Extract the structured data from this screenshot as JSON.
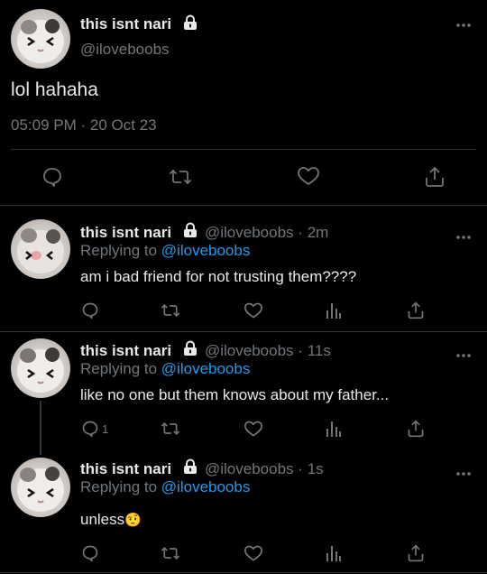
{
  "main_tweet": {
    "display_name": "this isnt nari",
    "handle": "@iloveboobs",
    "text": "lol hahaha",
    "time": "05:09 PM",
    "date": "20 Oct 23",
    "separator": "·"
  },
  "replies": [
    {
      "display_name": "this isnt nari",
      "handle": "@iloveboobs",
      "age": "2m",
      "replying_prefix": "Replying to",
      "replying_to": "@iloveboobs",
      "text": "am i bad friend for not trusting them????",
      "reply_count": ""
    },
    {
      "display_name": "this isnt nari",
      "handle": "@iloveboobs",
      "age": "11s",
      "replying_prefix": "Replying to",
      "replying_to": "@iloveboobs",
      "text": "like no one but them knows about my father...",
      "reply_count": "1"
    },
    {
      "display_name": "this isnt nari",
      "handle": "@iloveboobs",
      "age": "1s",
      "replying_prefix": "Replying to",
      "replying_to": "@iloveboobs",
      "text": "unless",
      "emoji": "🤨",
      "reply_count": ""
    }
  ],
  "icons": {
    "lock": "lock-icon",
    "more": "more-icon",
    "reply": "reply-icon",
    "retweet": "retweet-icon",
    "like": "like-icon",
    "share": "share-icon",
    "analytics": "analytics-icon"
  },
  "colors": {
    "background": "#000000",
    "text": "#e7e9ea",
    "muted": "#71767b",
    "link": "#1d9bf0",
    "divider": "#2f3336"
  }
}
